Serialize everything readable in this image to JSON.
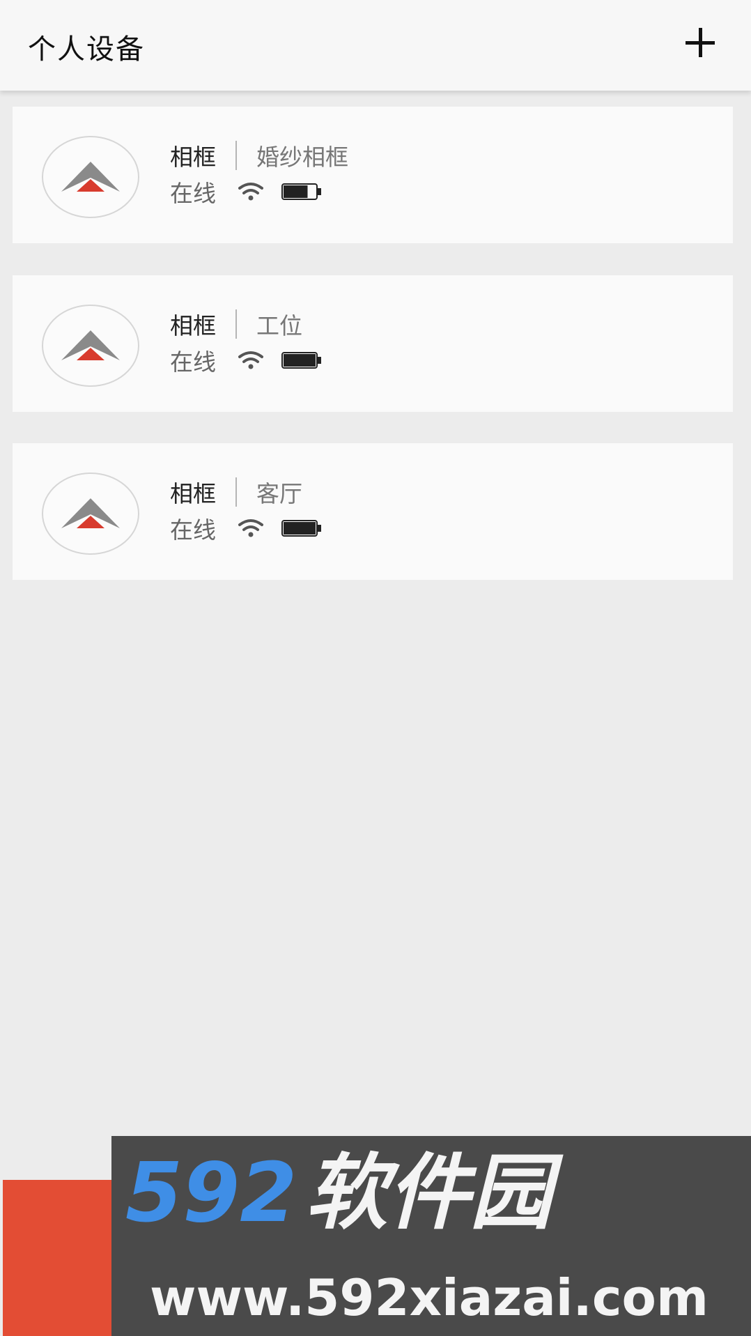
{
  "header": {
    "title": "个人设备",
    "add_icon": "plus-icon"
  },
  "devices": [
    {
      "type": "相框",
      "name": "婚纱相框",
      "status": "在线",
      "wifi_icon": "wifi-icon",
      "battery_icon": "battery-icon",
      "battery_level": 0.75
    },
    {
      "type": "相框",
      "name": "工位",
      "status": "在线",
      "wifi_icon": "wifi-icon",
      "battery_icon": "battery-icon",
      "battery_level": 1.0
    },
    {
      "type": "相框",
      "name": "客厅",
      "status": "在线",
      "wifi_icon": "wifi-icon",
      "battery_icon": "battery-icon",
      "battery_level": 1.0
    }
  ],
  "watermark": {
    "number": "592",
    "brand": "软件园",
    "url": "www.592xiazai.com"
  },
  "colors": {
    "accent_red": "#e34d34",
    "logo_red": "#d83b2e",
    "logo_gray": "#8a8a8a",
    "watermark_blue": "#3f8ee6"
  }
}
